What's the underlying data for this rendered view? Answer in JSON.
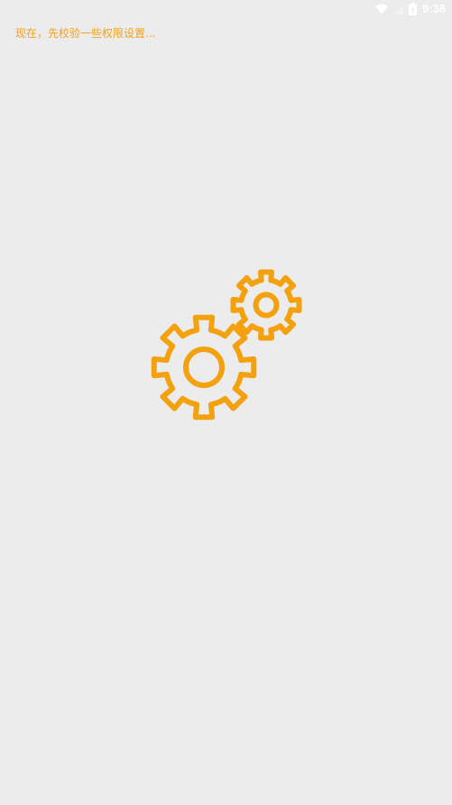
{
  "status_bar": {
    "time": "9:38",
    "icons": [
      "wifi-icon",
      "signal-icon",
      "battery-icon"
    ],
    "icon_color": "#ffffff"
  },
  "message": {
    "text": "现在，先校验一些权限设置...",
    "color": "#f2a11d"
  },
  "illustration": {
    "icon": "gears-icon",
    "color": "#f4a110"
  },
  "background_color": "#ececec"
}
